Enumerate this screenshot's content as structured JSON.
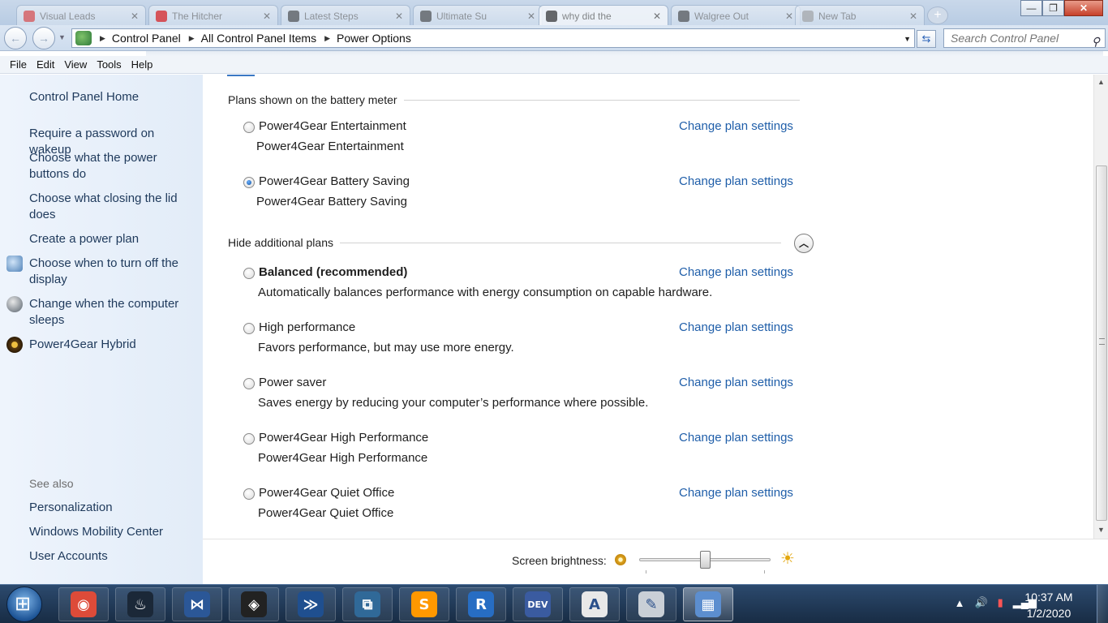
{
  "browser_tabs": [
    {
      "title": "Visual Leads"
    },
    {
      "title": "The Hitcher"
    },
    {
      "title": "Latest Steps"
    },
    {
      "title": "Ultimate Su"
    },
    {
      "title": "why did the"
    },
    {
      "title": "Walgree Out"
    },
    {
      "title": "New Tab"
    }
  ],
  "window_controls": {
    "minimize": "—",
    "maximize": "❐",
    "close": "✕"
  },
  "address_bar": {
    "breadcrumbs": [
      "Control Panel",
      "All Control Panel Items",
      "Power Options"
    ],
    "search_placeholder": "Search Control Panel"
  },
  "menu": [
    "File",
    "Edit",
    "View",
    "Tools",
    "Help"
  ],
  "left_nav": {
    "home": "Control Panel Home",
    "links": [
      {
        "label": "Require a password on wakeup",
        "icon": null
      },
      {
        "label": "Choose what the power buttons do",
        "icon": null
      },
      {
        "label": "Choose what closing the lid does",
        "icon": null
      },
      {
        "label": "Create a power plan",
        "icon": null
      },
      {
        "label": "Choose when to turn off the display",
        "icon": "display-icon"
      },
      {
        "label": "Change when the computer sleeps",
        "icon": "moon-icon"
      },
      {
        "label": "Power4Gear Hybrid",
        "icon": "power4gear-icon"
      }
    ],
    "see_also_heading": "See also",
    "see_also": [
      "Personalization",
      "Windows Mobility Center",
      "User Accounts"
    ]
  },
  "battery_meter": {
    "heading": "Plans shown on the battery meter",
    "plans": [
      {
        "name": "Power4Gear Entertainment",
        "description": "Power4Gear Entertainment",
        "selected": false,
        "link": "Change plan settings"
      },
      {
        "name": "Power4Gear Battery Saving",
        "description": "Power4Gear Battery Saving",
        "selected": true,
        "link": "Change plan settings"
      }
    ]
  },
  "additional": {
    "heading": "Hide additional plans",
    "collapse_glyph": "︿",
    "plans": [
      {
        "name": "Balanced (recommended)",
        "description": "Automatically balances performance with energy consumption on capable hardware.",
        "selected": false,
        "bold": true,
        "link": "Change plan settings"
      },
      {
        "name": "High performance",
        "description": "Favors performance, but may use more energy.",
        "selected": false,
        "link": "Change plan settings"
      },
      {
        "name": "Power saver",
        "description": "Saves energy by reducing your computer’s performance where possible.",
        "selected": false,
        "link": "Change plan settings"
      },
      {
        "name": "Power4Gear High Performance",
        "description": "Power4Gear High Performance",
        "selected": false,
        "link": "Change plan settings"
      },
      {
        "name": "Power4Gear Quiet Office",
        "description": "Power4Gear Quiet Office",
        "selected": false,
        "link": "Change plan settings"
      }
    ]
  },
  "brightness": {
    "label": "Screen brightness:",
    "level": 0.5
  },
  "taskbar": {
    "apps": [
      {
        "name": "chrome",
        "glyph": "◉",
        "color": "#dd4b39"
      },
      {
        "name": "steam",
        "glyph": "♨",
        "color": "#1b2838"
      },
      {
        "name": "visual-studio",
        "glyph": "⋈",
        "color": "#2b5797"
      },
      {
        "name": "unity",
        "glyph": "◈",
        "color": "#222222"
      },
      {
        "name": "powershell",
        "glyph": "≫",
        "color": "#1f4f8f"
      },
      {
        "name": "python",
        "glyph": "⧉",
        "color": "#306998"
      },
      {
        "name": "sublime",
        "glyph": "S",
        "color": "#ff9800"
      },
      {
        "name": "r",
        "glyph": "R",
        "color": "#276dc3"
      },
      {
        "name": "dev-cpp",
        "glyph": "DEV",
        "color": "#3a5ba0"
      },
      {
        "name": "wordpad",
        "glyph": "A",
        "color": "#e8e8e8"
      },
      {
        "name": "paint",
        "glyph": "✎",
        "color": "#c9cfd6"
      },
      {
        "name": "control-panel",
        "glyph": "▦",
        "color": "#5c8ecf"
      }
    ],
    "time": "10:37 AM",
    "date": "1/2/2020"
  }
}
